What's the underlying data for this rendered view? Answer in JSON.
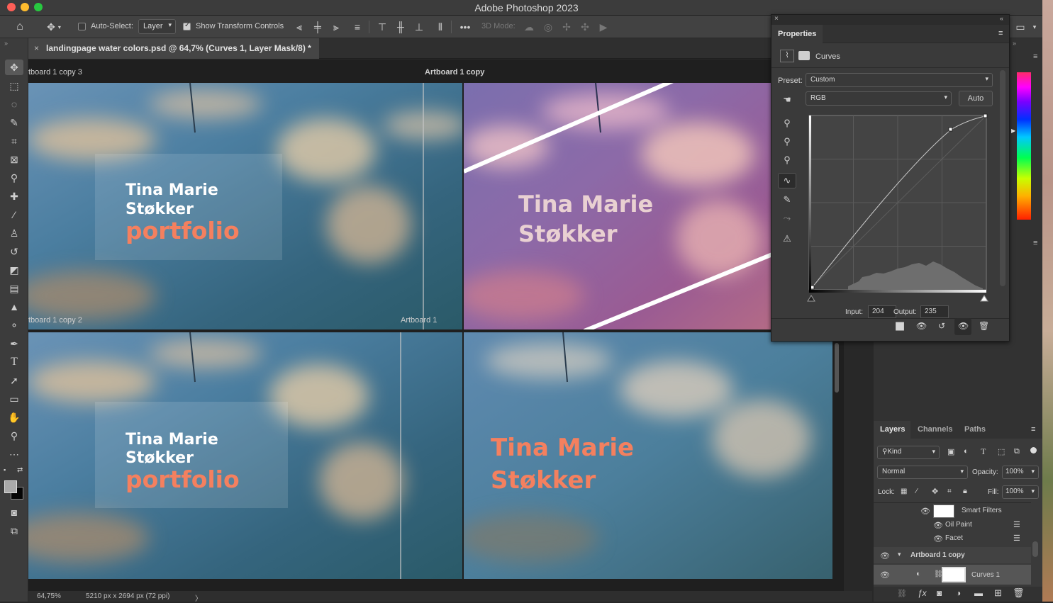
{
  "window": {
    "title": "Adobe Photoshop 2023"
  },
  "options_bar": {
    "auto_select_label": "Auto-Select:",
    "auto_select_value": "Layer",
    "show_transform_label": "Show Transform Controls",
    "mode_3d_label": "3D Mode:",
    "more_label": "•••"
  },
  "document": {
    "tab_title": "landingpage water colors.psd @ 64,7% (Curves 1, Layer Mask/8) *",
    "zoom": "64,75%",
    "dimensions": "5210 px x 2694 px (72 ppi)"
  },
  "artboards": {
    "label_copy3": "tboard 1 copy 3",
    "label_copy": "Artboard 1 copy",
    "label_copy2": "tboard 1 copy 2",
    "label_ab1": "Artboard 1",
    "tl": {
      "line1": "Tina Marie",
      "line2": "Støkker",
      "line3": "portfolio"
    },
    "tr": {
      "line1": "Tina Marie",
      "line2": "Støkker"
    },
    "bl": {
      "line1": "Tina Marie",
      "line2": "Støkker",
      "line3": "portfolio"
    },
    "br": {
      "line1": "Tina Marie",
      "line2": "Støkker"
    },
    "accent": "#f4805f"
  },
  "properties": {
    "title": "Properties",
    "adjustment": "Curves",
    "preset_label": "Preset:",
    "preset_value": "Custom",
    "channel_value": "RGB",
    "auto_label": "Auto",
    "input_label": "Input:",
    "input_value": "204",
    "output_label": "Output:",
    "output_value": "235"
  },
  "layers_panel": {
    "tabs": [
      "Layers",
      "Channels",
      "Paths"
    ],
    "filter_kind": "Kind",
    "blend_mode": "Normal",
    "opacity_label": "Opacity:",
    "opacity_value": "100%",
    "lock_label": "Lock:",
    "fill_label": "Fill:",
    "fill_value": "100%",
    "rows": {
      "smart_filters": "Smart Filters",
      "oil_paint": "Oil Paint",
      "facet": "Facet",
      "artboard": "Artboard 1 copy",
      "curves": "Curves 1"
    }
  }
}
